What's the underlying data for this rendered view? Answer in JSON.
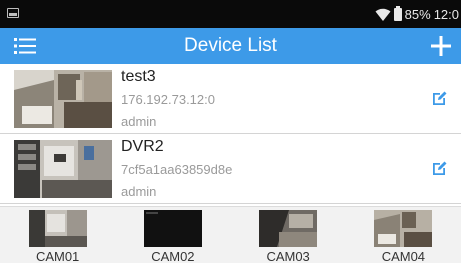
{
  "status_bar": {
    "battery_percent": "85%",
    "time": "12:0",
    "wifi_icon": "wifi-icon",
    "battery_icon": "battery-icon",
    "notification_icon": "screenshot-icon"
  },
  "app_bar": {
    "title": "Device List",
    "menu_icon": "hamburger-menu-icon",
    "add_icon": "plus-icon",
    "color": "#3d9ae8"
  },
  "devices": [
    {
      "name": "test3",
      "address": "176.192.73.12:0",
      "user": "admin",
      "edit_icon": "edit-icon"
    },
    {
      "name": "DVR2",
      "address": "7cf5a1aa63859d8e",
      "user": "admin",
      "edit_icon": "edit-icon"
    }
  ],
  "cameras": [
    {
      "label": "CAM01"
    },
    {
      "label": "CAM02"
    },
    {
      "label": "CAM03"
    },
    {
      "label": "CAM04"
    }
  ],
  "colors": {
    "accent": "#3d9ae8",
    "edit_icon": "#3d9ae8",
    "secondary_text": "#9a9a9a"
  }
}
